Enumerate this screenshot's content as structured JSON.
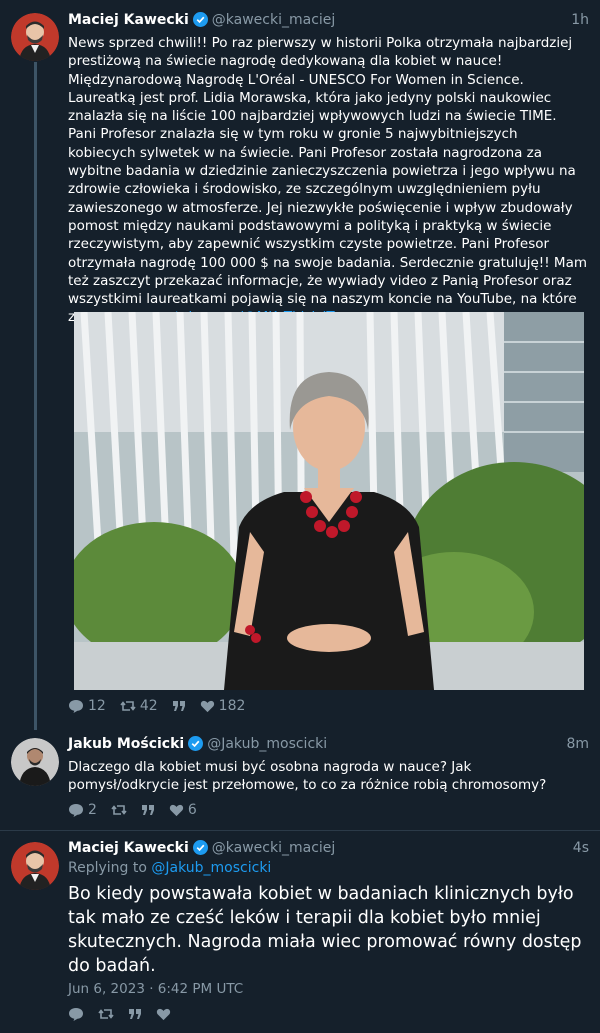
{
  "tweets": [
    {
      "name": "Maciej Kawecki",
      "handle": "@kawecki_maciej",
      "time": "1h",
      "text": "News sprzed chwili!! Po raz pierwszy w historii Polka otrzymała najbardziej prestiżową na świecie nagrodę dedykowaną dla kobiet w nauce! Międzynarodową Nagrodę L'Oréal - UNESCO For Women in Science. Laureatką jest prof. Lidia Morawska, która jako jedyny polski naukowiec znalazła się na liście 100 najbardziej wpływowych ludzi na świecie TIME. Pani Profesor znalazła się w tym roku w gronie 5 najwybitniejszych kobiecych sylwetek w na świecie. Pani Profesor została nagrodzona za wybitne badania w dziedzinie zanieczyszczenia powietrza i jego wpływu na zdrowie człowieka i środowisko, ze szczególnym uwzględnieniem pyłu zawieszonego w atmosferze. Jej niezwykłe poświęcenie i wpływ zbudowały pomost między naukami podstawowymi a polityką i praktyką w świecie rzeczywistym, aby zapewnić wszystkim czyste powietrze. Pani Profesor otrzymała nagrodę 100 000 $ na swoje badania. Serdecznie gratuluję!! Mam też zaszczyt przekazać informacje, że wywiady video z Panią Profesor oraz wszystkimi laureatkami pojawią się na naszym koncie na YouTube, na które zapraszam.",
      "link": "youtube.com/@MK_ThisIsIT",
      "replies": "12",
      "retweets": "42",
      "likes": "182"
    },
    {
      "name": "Jakub Mościcki",
      "handle": "@Jakub_moscicki",
      "time": "8m",
      "text": "Dlaczego dla kobiet musi być osobna nagroda w nauce? Jak pomysł/odkrycie jest przełomowe, to co za różnice robią chromosomy?",
      "replies": "2",
      "retweets": "",
      "likes": "6"
    },
    {
      "name": "Maciej Kawecki",
      "handle": "@kawecki_maciej",
      "time": "4s",
      "replying_prefix": "Replying to",
      "replying_to": "@Jakub_moscicki",
      "text": "Bo kiedy powstawała kobiet w badaniach klinicznych było tak mało ze cześć leków i terapii dla kobiet było mniej skutecznych. Nagroda miała wiec promować równy dostęp do badań.",
      "date": "Jun 6, 2023 · 6:42 PM UTC"
    }
  ],
  "icons": [
    "reply-icon",
    "retweet-icon",
    "quote-icon",
    "heart-icon",
    "verified-badge-icon"
  ],
  "colors": {
    "background": "#15202b",
    "link": "#1d9bf0",
    "muted": "#8899a6",
    "thread_line": "#3d5466"
  }
}
